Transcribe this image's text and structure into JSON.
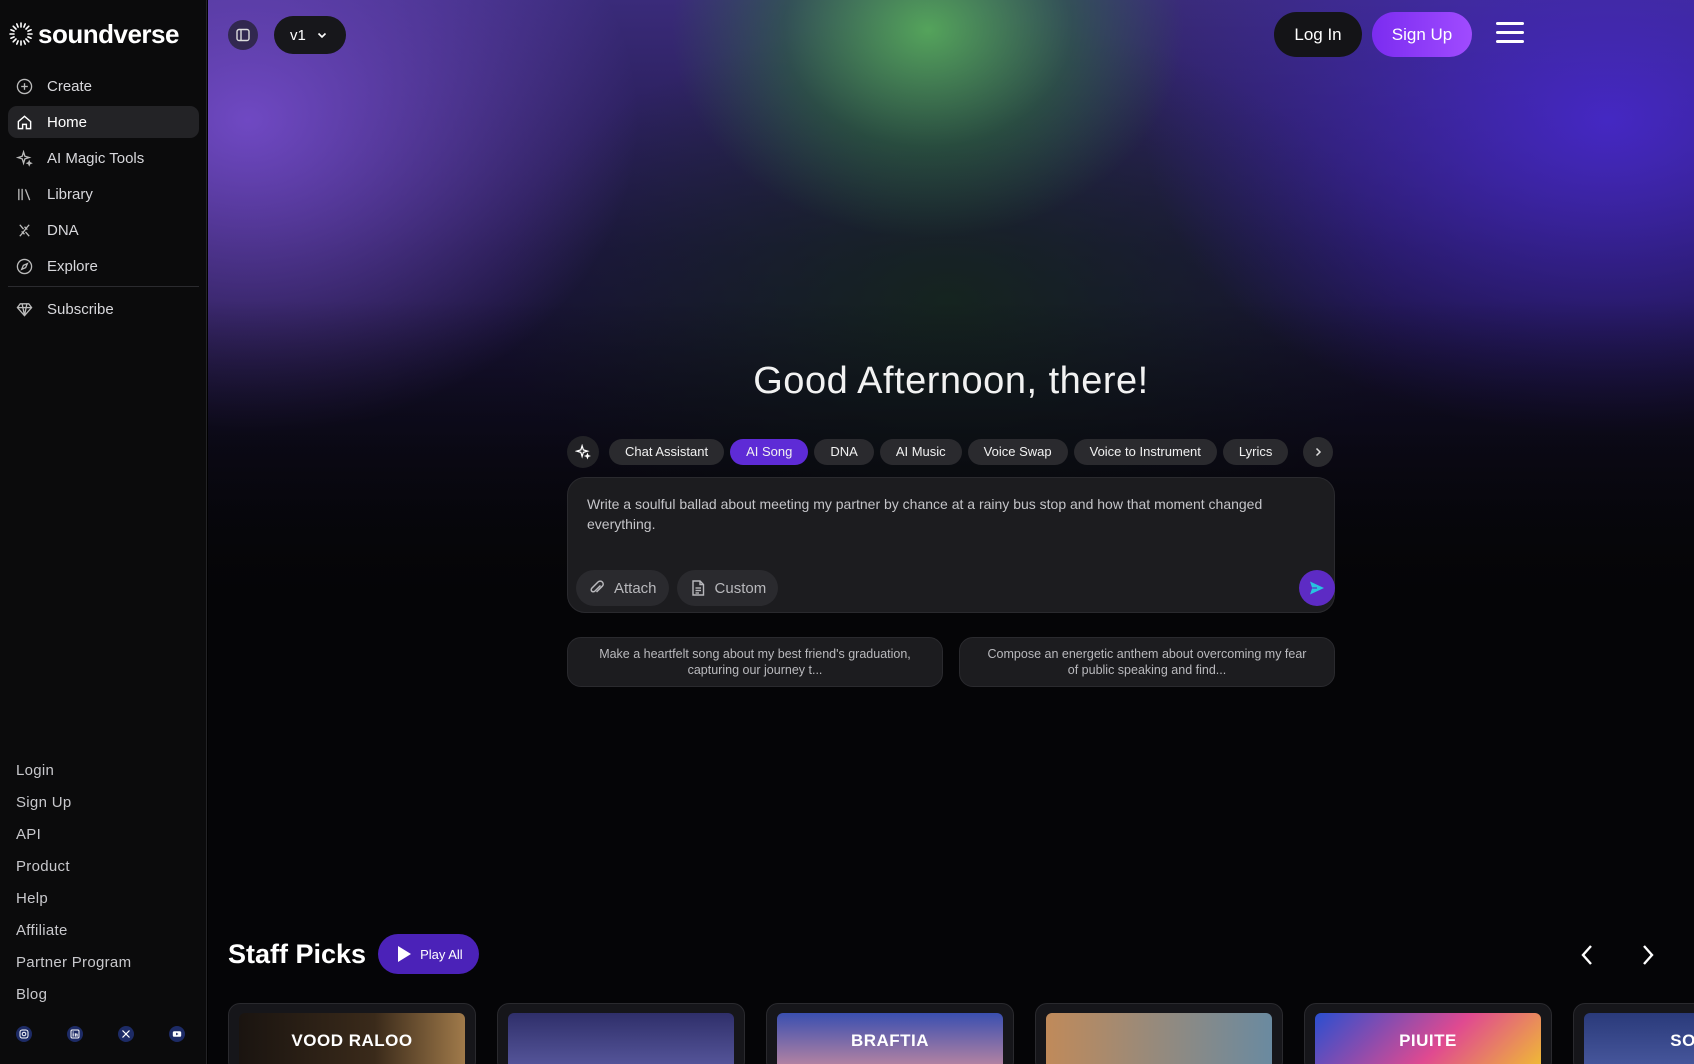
{
  "brand": {
    "name": "soundverse"
  },
  "sidebar": {
    "items": [
      {
        "label": "Create",
        "icon": "plus-circle-icon"
      },
      {
        "label": "Home",
        "icon": "home-icon",
        "active": true
      },
      {
        "label": "AI Magic Tools",
        "icon": "sparkle-icon"
      },
      {
        "label": "Library",
        "icon": "library-icon"
      },
      {
        "label": "DNA",
        "icon": "dna-icon"
      },
      {
        "label": "Explore",
        "icon": "compass-icon"
      }
    ],
    "subscribe": {
      "label": "Subscribe",
      "icon": "gem-icon"
    },
    "footer_links": [
      "Login",
      "Sign Up",
      "API",
      "Product",
      "Help",
      "Affiliate",
      "Partner Program",
      "Blog"
    ],
    "socials": [
      "instagram-icon",
      "linkedin-icon",
      "x-icon",
      "youtube-icon"
    ]
  },
  "header": {
    "version": "v1",
    "login_label": "Log In",
    "signup_label": "Sign Up"
  },
  "hero": {
    "greeting": "Good Afternoon, there!",
    "tabs": [
      "Chat Assistant",
      "AI Song",
      "DNA",
      "AI Music",
      "Voice Swap",
      "Voice to Instrument",
      "Lyrics"
    ],
    "active_tab": "AI Song",
    "prompt_text": "Write a soulful ballad about meeting my partner by chance at a rainy bus stop and how that moment changed everything.",
    "attach_label": "Attach",
    "custom_label": "Custom",
    "suggestions": [
      "Make a heartfelt song about my best friend's graduation, capturing our journey t...",
      "Compose an energetic anthem about overcoming my fear of public speaking and find..."
    ]
  },
  "staff_picks": {
    "title": "Staff Picks",
    "play_all_label": "Play All",
    "cards": [
      {
        "art_text": "VOOD RALOO",
        "bg": "#3a2a1a"
      },
      {
        "art_text": "",
        "bg": "#2f2f6a"
      },
      {
        "art_text": "BRAFTIA",
        "bg": "#3a4fb0"
      },
      {
        "art_text": "",
        "bg": "#8a5a3a"
      },
      {
        "art_text": "PIUITE",
        "bg": "#2a4fd0"
      },
      {
        "art_text": "SOITE",
        "bg": "#2a3a7a"
      }
    ]
  },
  "colors": {
    "accent": "#5e2bd6",
    "signup_gradient_start": "#7b2cf0",
    "signup_gradient_end": "#a04bff"
  }
}
